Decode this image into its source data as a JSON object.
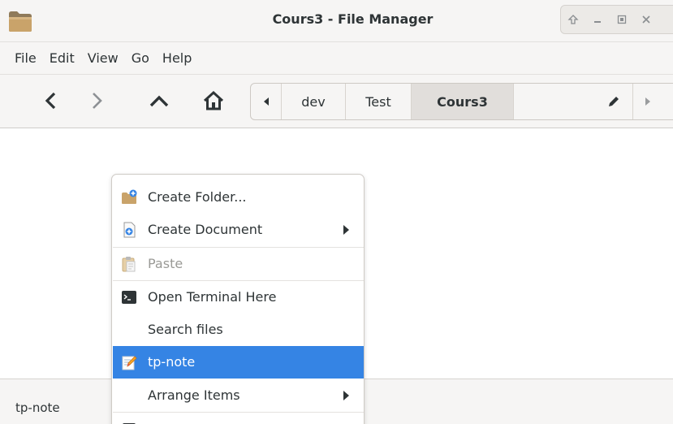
{
  "window": {
    "title": "Cours3 - File Manager",
    "controls": [
      "roll-up",
      "minimize",
      "maximize",
      "close"
    ]
  },
  "menubar": {
    "items": [
      "File",
      "Edit",
      "View",
      "Go",
      "Help"
    ]
  },
  "toolbar": {
    "buttons": [
      "back",
      "forward",
      "up",
      "home"
    ],
    "path": [
      "dev",
      "Test",
      "Cours3"
    ],
    "active_segment": "Cours3"
  },
  "context_menu": {
    "items": [
      {
        "label": "Create Folder...",
        "icon": "folder-new-icon"
      },
      {
        "label": "Create Document",
        "icon": "document-new-icon",
        "submenu": true
      },
      {
        "label": "Paste",
        "icon": "clipboard-icon",
        "disabled": true
      },
      {
        "label": "Open Terminal Here",
        "icon": "terminal-icon"
      },
      {
        "label": "Search files",
        "icon": ""
      },
      {
        "label": "tp-note",
        "icon": "note-edit-icon",
        "highlighted": true
      },
      {
        "label": "Arrange Items",
        "icon": "",
        "submenu": true
      }
    ]
  },
  "statusbar": {
    "text": "tp-note"
  },
  "colors": {
    "highlight": "#3584e4",
    "chrome": "#f6f5f4",
    "folder": "#c9a36a"
  }
}
